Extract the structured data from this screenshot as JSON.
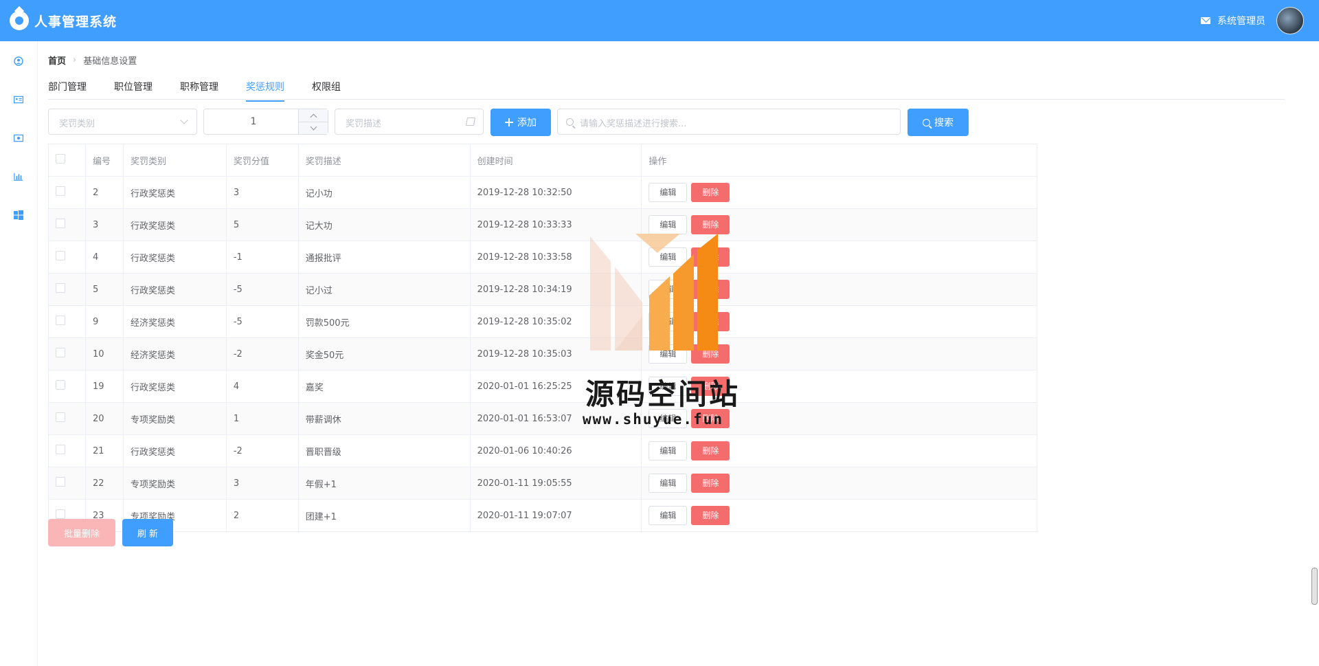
{
  "app": {
    "title": "人事管理系统",
    "user_name": "系统管理员"
  },
  "sidebar": {
    "items": [
      {
        "icon": "user-icon"
      },
      {
        "icon": "id-card-icon"
      },
      {
        "icon": "money-icon"
      },
      {
        "icon": "bar-chart-icon"
      },
      {
        "icon": "windows-icon"
      }
    ]
  },
  "breadcrumb": {
    "home": "首页",
    "current": "基础信息设置"
  },
  "tabs": [
    {
      "label": "部门管理",
      "active": false
    },
    {
      "label": "职位管理",
      "active": false
    },
    {
      "label": "职称管理",
      "active": false
    },
    {
      "label": "奖惩规则",
      "active": true
    },
    {
      "label": "权限组",
      "active": false
    }
  ],
  "toolbar": {
    "category_placeholder": "奖罚类别",
    "score_value": "1",
    "desc_placeholder": "奖罚描述",
    "add_label": "添加",
    "search_placeholder": "请输入奖惩描述进行搜索...",
    "search_label": "搜索"
  },
  "table": {
    "headers": [
      "编号",
      "奖罚类别",
      "奖罚分值",
      "奖罚描述",
      "创建时间",
      "操作"
    ],
    "edit_label": "编辑",
    "delete_label": "删除",
    "rows": [
      {
        "id": "2",
        "category": "行政奖惩类",
        "score": "3",
        "desc": "记小功",
        "time": "2019-12-28 10:32:50"
      },
      {
        "id": "3",
        "category": "行政奖惩类",
        "score": "5",
        "desc": "记大功",
        "time": "2019-12-28 10:33:33"
      },
      {
        "id": "4",
        "category": "行政奖惩类",
        "score": "-1",
        "desc": "通报批评",
        "time": "2019-12-28 10:33:58"
      },
      {
        "id": "5",
        "category": "行政奖惩类",
        "score": "-5",
        "desc": "记小过",
        "time": "2019-12-28 10:34:19"
      },
      {
        "id": "9",
        "category": "经济奖惩类",
        "score": "-5",
        "desc": "罚款500元",
        "time": "2019-12-28 10:35:02"
      },
      {
        "id": "10",
        "category": "经济奖惩类",
        "score": "-2",
        "desc": "奖金50元",
        "time": "2019-12-28 10:35:03"
      },
      {
        "id": "19",
        "category": "行政奖惩类",
        "score": "4",
        "desc": "嘉奖",
        "time": "2020-01-01 16:25:25"
      },
      {
        "id": "20",
        "category": "专项奖励类",
        "score": "1",
        "desc": "带薪调休",
        "time": "2020-01-01 16:53:07"
      },
      {
        "id": "21",
        "category": "行政奖惩类",
        "score": "-2",
        "desc": "晋职晋级",
        "time": "2020-01-06 10:40:26"
      },
      {
        "id": "22",
        "category": "专项奖励类",
        "score": "3",
        "desc": "年假+1",
        "time": "2020-01-11 19:05:55"
      },
      {
        "id": "23",
        "category": "专项奖励类",
        "score": "2",
        "desc": "团建+1",
        "time": "2020-01-11 19:07:07"
      }
    ]
  },
  "footer": {
    "batch_delete_label": "批量删除",
    "refresh_label": "刷 新"
  },
  "watermark": {
    "title": "源码空间站",
    "url": "www.shuyue.fun"
  },
  "colors": {
    "primary": "#409eff",
    "danger": "#f56c6c",
    "danger_light": "#fab6b6"
  }
}
